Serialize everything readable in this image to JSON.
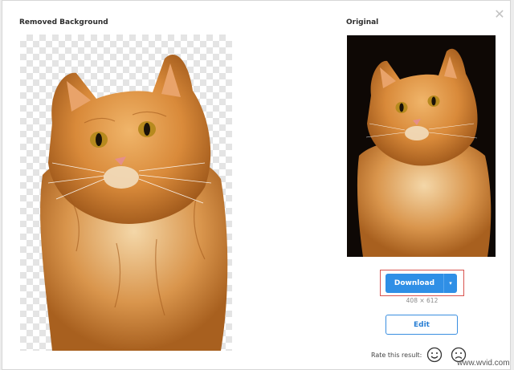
{
  "panels": {
    "removed_background_label": "Removed Background",
    "original_label": "Original"
  },
  "close_icon": "close-icon",
  "download": {
    "label": "Download",
    "caret": "▾",
    "dimensions": "408 × 612"
  },
  "edit": {
    "label": "Edit"
  },
  "rating": {
    "label": "Rate this result:",
    "happy_icon": "smile-icon",
    "sad_icon": "frown-icon"
  },
  "watermark": "www.wvid.com",
  "colors": {
    "accent": "#2f8fe6",
    "highlight": "#d9534f",
    "cat_fur": "#d98a3a"
  }
}
